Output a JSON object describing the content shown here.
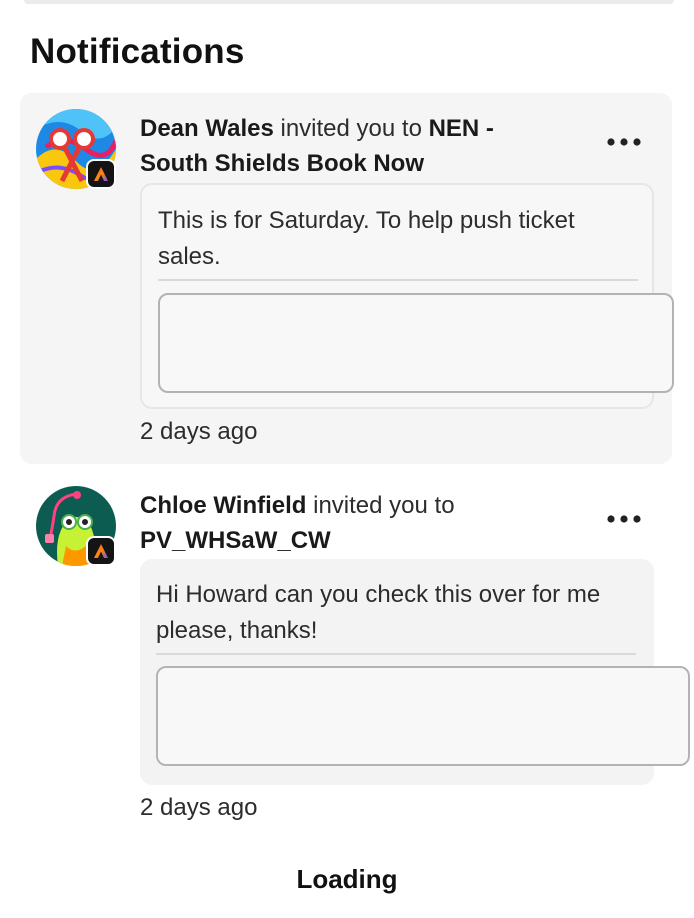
{
  "panel": {
    "title": "Notifications"
  },
  "notifications": [
    {
      "sender": "Dean Wales",
      "action": "invited you to",
      "target": "NEN - South Shields Book Now",
      "message": "This is for Saturday. To help push ticket sales.",
      "time": "2 days ago",
      "avatar_icon": "scissors-avatar",
      "badge_icon": "adobe-express-icon"
    },
    {
      "sender": "Chloe Winfield",
      "action": "invited you to",
      "target": "PV_WHSaW_CW",
      "message": "Hi Howard can you check this over for me please, thanks!",
      "time": "2 days ago",
      "avatar_icon": "creature-avatar",
      "badge_icon": "adobe-express-icon"
    }
  ],
  "footer": {
    "loading_label": "Loading"
  },
  "colors": {
    "highlight_background": "#f5f5f5",
    "text": "#2c2c2c",
    "badge": "#141414"
  }
}
